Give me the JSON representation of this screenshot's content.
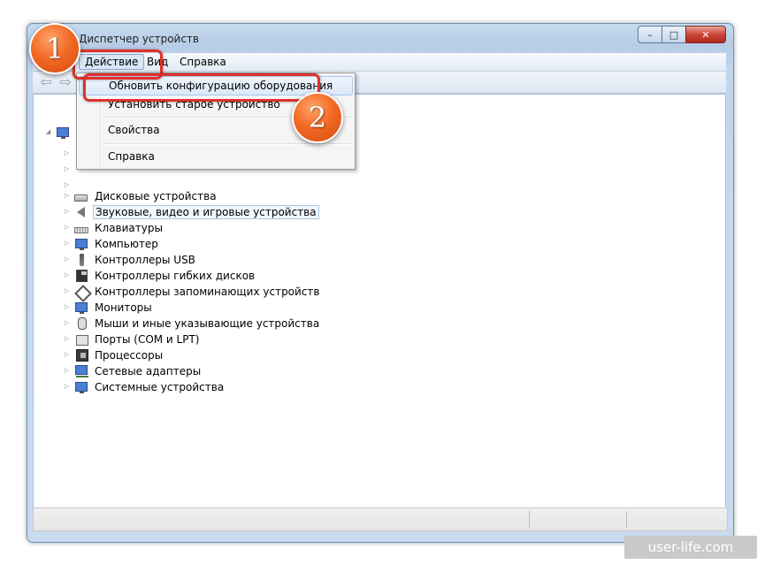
{
  "window": {
    "title": "Диспетчер устройств",
    "controls": {
      "minimize": "–",
      "maximize": "□",
      "close": "✕"
    }
  },
  "menubar": {
    "items": [
      {
        "label": "Действие"
      },
      {
        "label": "Вид"
      },
      {
        "label": "Справка"
      }
    ]
  },
  "toolbar": {
    "back_icon": "arrow-left-icon",
    "forward_icon": "arrow-right-icon"
  },
  "dropdown": {
    "items": [
      {
        "label": "Обновить конфигурацию оборудования"
      },
      {
        "label": "Установить старое устройство"
      },
      {
        "label": "Свойства"
      },
      {
        "label": "Справка"
      }
    ]
  },
  "tree": {
    "nodes": [
      {
        "label": "Дисковые устройства",
        "icon": "disk-drive-icon"
      },
      {
        "label": "Звуковые, видео и игровые устройства",
        "icon": "speaker-icon",
        "selected": true
      },
      {
        "label": "Клавиатуры",
        "icon": "keyboard-icon"
      },
      {
        "label": "Компьютер",
        "icon": "computer-icon"
      },
      {
        "label": "Контроллеры USB",
        "icon": "usb-icon"
      },
      {
        "label": "Контроллеры гибких дисков",
        "icon": "floppy-icon"
      },
      {
        "label": "Контроллеры запоминающих устройств",
        "icon": "storage-controller-icon"
      },
      {
        "label": "Мониторы",
        "icon": "monitor-icon"
      },
      {
        "label": "Мыши и иные указывающие устройства",
        "icon": "mouse-icon"
      },
      {
        "label": "Порты (COM и LPT)",
        "icon": "port-icon"
      },
      {
        "label": "Процессоры",
        "icon": "processor-icon"
      },
      {
        "label": "Сетевые адаптеры",
        "icon": "network-adapter-icon"
      },
      {
        "label": "Системные устройства",
        "icon": "system-devices-icon"
      }
    ]
  },
  "annotations": {
    "step1": "1",
    "step2": "2"
  },
  "watermark": "user-life.com",
  "colors": {
    "highlight_red": "#e0312a",
    "badge_orange": "#f36a26",
    "window_frame": "#c6daef"
  }
}
